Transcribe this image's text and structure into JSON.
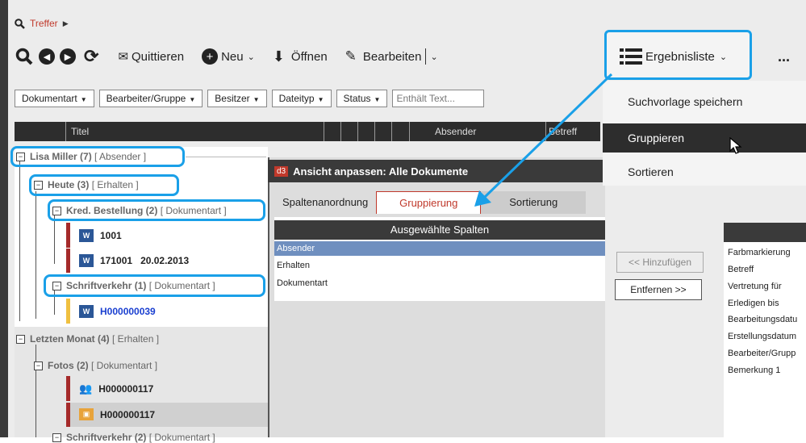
{
  "breadcrumb": {
    "icon": "search-icon",
    "label": "Treffer"
  },
  "toolbar": {
    "quittieren": "Quittieren",
    "neu": "Neu",
    "oeffnen": "Öffnen",
    "bearbeiten": "Bearbeiten",
    "ergebnisliste": "Ergebnisliste",
    "more": "..."
  },
  "filters": {
    "dokumentart": "Dokumentart",
    "bearbeiter": "Bearbeiter/Gruppe",
    "besitzer": "Besitzer",
    "dateityp": "Dateityp",
    "status": "Status",
    "text_placeholder": "Enthält Text..."
  },
  "columns": {
    "titel": "Titel",
    "absender": "Absender",
    "betreff": "Betreff"
  },
  "tree": {
    "g1": {
      "name": "Lisa Miller (7)",
      "tag": "[ Absender ]"
    },
    "g2": {
      "name": "Heute (3)",
      "tag": "[ Erhalten ]"
    },
    "g3": {
      "name": "Kred. Bestellung (2)",
      "tag": "[ Dokumentart ]"
    },
    "d1": {
      "title": "1001"
    },
    "d2": {
      "title": "171001",
      "date": "20.02.2013"
    },
    "g4": {
      "name": "Schriftverkehr (1)",
      "tag": "[ Dokumentart ]"
    },
    "d3": {
      "title": "H000000039"
    },
    "g5": {
      "name": "Letzten Monat (4)",
      "tag": "[ Erhalten ]"
    },
    "g6": {
      "name": "Fotos (2)",
      "tag": "[ Dokumentart ]"
    },
    "d4": {
      "title": "H000000117"
    },
    "d5": {
      "title": "H000000117"
    },
    "g7": {
      "name": "Schriftverkehr (2)",
      "tag": "[ Dokumentart ]"
    }
  },
  "dialog": {
    "logo": "d3",
    "title": "Ansicht anpassen: Alle Dokumente",
    "tabs": [
      "Spaltenanordnung",
      "Gruppierung",
      "Sortierung"
    ],
    "selected_header": "Ausgewählte Spalten",
    "selected": [
      "Absender",
      "Erhalten",
      "Dokumentart"
    ],
    "add": "<< Hinzufügen",
    "remove": "Entfernen >>",
    "available": [
      "Farbmarkierung",
      "Betreff",
      "Vertretung für",
      "Erledigen bis",
      "Bearbeitungsdatu",
      "Erstellungsdatum",
      "Bearbeiter/Grupp",
      "Bemerkung 1"
    ]
  },
  "menu": {
    "items": [
      "Suchvorlage speichern",
      "Gruppieren",
      "Sortieren"
    ]
  },
  "colors": {
    "accent": "#c0392b",
    "callout": "#1aa0e8",
    "link": "#1a3fd0"
  }
}
